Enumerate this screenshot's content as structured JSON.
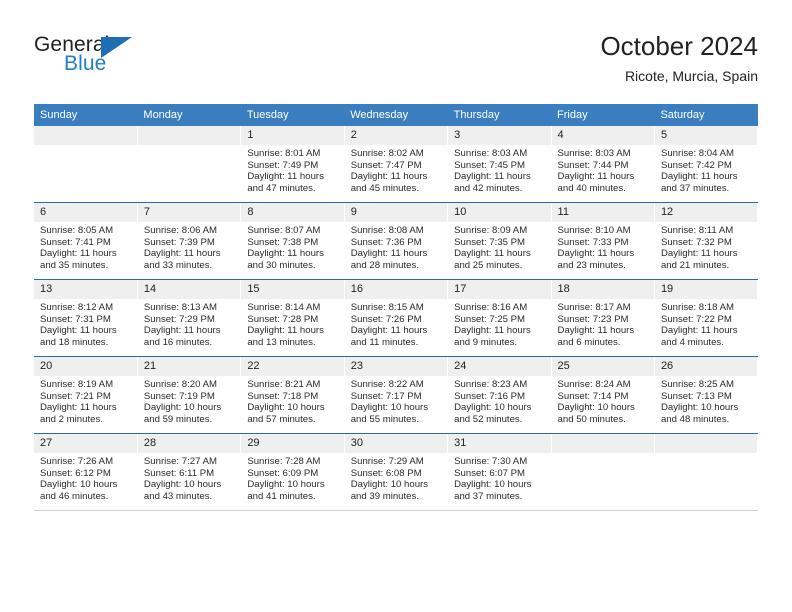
{
  "brand": {
    "name_top": "General",
    "name_bottom": "Blue",
    "accent_color": "#1f7ec4",
    "triangle_color": "#1f6db5"
  },
  "header": {
    "title": "October 2024",
    "location": "Ricote, Murcia, Spain"
  },
  "theme": {
    "header_blue": "#3b7ebf",
    "row_border_blue": "#2a6bab",
    "daynum_band": "#efefef",
    "text": "#222222"
  },
  "weekday_headers": [
    "Sunday",
    "Monday",
    "Tuesday",
    "Wednesday",
    "Thursday",
    "Friday",
    "Saturday"
  ],
  "weeks": [
    [
      {
        "day": "",
        "sunrise": "",
        "sunset": "",
        "daylight_line1": "",
        "daylight_line2": ""
      },
      {
        "day": "",
        "sunrise": "",
        "sunset": "",
        "daylight_line1": "",
        "daylight_line2": ""
      },
      {
        "day": "1",
        "sunrise": "Sunrise: 8:01 AM",
        "sunset": "Sunset: 7:49 PM",
        "daylight_line1": "Daylight: 11 hours",
        "daylight_line2": "and 47 minutes."
      },
      {
        "day": "2",
        "sunrise": "Sunrise: 8:02 AM",
        "sunset": "Sunset: 7:47 PM",
        "daylight_line1": "Daylight: 11 hours",
        "daylight_line2": "and 45 minutes."
      },
      {
        "day": "3",
        "sunrise": "Sunrise: 8:03 AM",
        "sunset": "Sunset: 7:45 PM",
        "daylight_line1": "Daylight: 11 hours",
        "daylight_line2": "and 42 minutes."
      },
      {
        "day": "4",
        "sunrise": "Sunrise: 8:03 AM",
        "sunset": "Sunset: 7:44 PM",
        "daylight_line1": "Daylight: 11 hours",
        "daylight_line2": "and 40 minutes."
      },
      {
        "day": "5",
        "sunrise": "Sunrise: 8:04 AM",
        "sunset": "Sunset: 7:42 PM",
        "daylight_line1": "Daylight: 11 hours",
        "daylight_line2": "and 37 minutes."
      }
    ],
    [
      {
        "day": "6",
        "sunrise": "Sunrise: 8:05 AM",
        "sunset": "Sunset: 7:41 PM",
        "daylight_line1": "Daylight: 11 hours",
        "daylight_line2": "and 35 minutes."
      },
      {
        "day": "7",
        "sunrise": "Sunrise: 8:06 AM",
        "sunset": "Sunset: 7:39 PM",
        "daylight_line1": "Daylight: 11 hours",
        "daylight_line2": "and 33 minutes."
      },
      {
        "day": "8",
        "sunrise": "Sunrise: 8:07 AM",
        "sunset": "Sunset: 7:38 PM",
        "daylight_line1": "Daylight: 11 hours",
        "daylight_line2": "and 30 minutes."
      },
      {
        "day": "9",
        "sunrise": "Sunrise: 8:08 AM",
        "sunset": "Sunset: 7:36 PM",
        "daylight_line1": "Daylight: 11 hours",
        "daylight_line2": "and 28 minutes."
      },
      {
        "day": "10",
        "sunrise": "Sunrise: 8:09 AM",
        "sunset": "Sunset: 7:35 PM",
        "daylight_line1": "Daylight: 11 hours",
        "daylight_line2": "and 25 minutes."
      },
      {
        "day": "11",
        "sunrise": "Sunrise: 8:10 AM",
        "sunset": "Sunset: 7:33 PM",
        "daylight_line1": "Daylight: 11 hours",
        "daylight_line2": "and 23 minutes."
      },
      {
        "day": "12",
        "sunrise": "Sunrise: 8:11 AM",
        "sunset": "Sunset: 7:32 PM",
        "daylight_line1": "Daylight: 11 hours",
        "daylight_line2": "and 21 minutes."
      }
    ],
    [
      {
        "day": "13",
        "sunrise": "Sunrise: 8:12 AM",
        "sunset": "Sunset: 7:31 PM",
        "daylight_line1": "Daylight: 11 hours",
        "daylight_line2": "and 18 minutes."
      },
      {
        "day": "14",
        "sunrise": "Sunrise: 8:13 AM",
        "sunset": "Sunset: 7:29 PM",
        "daylight_line1": "Daylight: 11 hours",
        "daylight_line2": "and 16 minutes."
      },
      {
        "day": "15",
        "sunrise": "Sunrise: 8:14 AM",
        "sunset": "Sunset: 7:28 PM",
        "daylight_line1": "Daylight: 11 hours",
        "daylight_line2": "and 13 minutes."
      },
      {
        "day": "16",
        "sunrise": "Sunrise: 8:15 AM",
        "sunset": "Sunset: 7:26 PM",
        "daylight_line1": "Daylight: 11 hours",
        "daylight_line2": "and 11 minutes."
      },
      {
        "day": "17",
        "sunrise": "Sunrise: 8:16 AM",
        "sunset": "Sunset: 7:25 PM",
        "daylight_line1": "Daylight: 11 hours",
        "daylight_line2": "and 9 minutes."
      },
      {
        "day": "18",
        "sunrise": "Sunrise: 8:17 AM",
        "sunset": "Sunset: 7:23 PM",
        "daylight_line1": "Daylight: 11 hours",
        "daylight_line2": "and 6 minutes."
      },
      {
        "day": "19",
        "sunrise": "Sunrise: 8:18 AM",
        "sunset": "Sunset: 7:22 PM",
        "daylight_line1": "Daylight: 11 hours",
        "daylight_line2": "and 4 minutes."
      }
    ],
    [
      {
        "day": "20",
        "sunrise": "Sunrise: 8:19 AM",
        "sunset": "Sunset: 7:21 PM",
        "daylight_line1": "Daylight: 11 hours",
        "daylight_line2": "and 2 minutes."
      },
      {
        "day": "21",
        "sunrise": "Sunrise: 8:20 AM",
        "sunset": "Sunset: 7:19 PM",
        "daylight_line1": "Daylight: 10 hours",
        "daylight_line2": "and 59 minutes."
      },
      {
        "day": "22",
        "sunrise": "Sunrise: 8:21 AM",
        "sunset": "Sunset: 7:18 PM",
        "daylight_line1": "Daylight: 10 hours",
        "daylight_line2": "and 57 minutes."
      },
      {
        "day": "23",
        "sunrise": "Sunrise: 8:22 AM",
        "sunset": "Sunset: 7:17 PM",
        "daylight_line1": "Daylight: 10 hours",
        "daylight_line2": "and 55 minutes."
      },
      {
        "day": "24",
        "sunrise": "Sunrise: 8:23 AM",
        "sunset": "Sunset: 7:16 PM",
        "daylight_line1": "Daylight: 10 hours",
        "daylight_line2": "and 52 minutes."
      },
      {
        "day": "25",
        "sunrise": "Sunrise: 8:24 AM",
        "sunset": "Sunset: 7:14 PM",
        "daylight_line1": "Daylight: 10 hours",
        "daylight_line2": "and 50 minutes."
      },
      {
        "day": "26",
        "sunrise": "Sunrise: 8:25 AM",
        "sunset": "Sunset: 7:13 PM",
        "daylight_line1": "Daylight: 10 hours",
        "daylight_line2": "and 48 minutes."
      }
    ],
    [
      {
        "day": "27",
        "sunrise": "Sunrise: 7:26 AM",
        "sunset": "Sunset: 6:12 PM",
        "daylight_line1": "Daylight: 10 hours",
        "daylight_line2": "and 46 minutes."
      },
      {
        "day": "28",
        "sunrise": "Sunrise: 7:27 AM",
        "sunset": "Sunset: 6:11 PM",
        "daylight_line1": "Daylight: 10 hours",
        "daylight_line2": "and 43 minutes."
      },
      {
        "day": "29",
        "sunrise": "Sunrise: 7:28 AM",
        "sunset": "Sunset: 6:09 PM",
        "daylight_line1": "Daylight: 10 hours",
        "daylight_line2": "and 41 minutes."
      },
      {
        "day": "30",
        "sunrise": "Sunrise: 7:29 AM",
        "sunset": "Sunset: 6:08 PM",
        "daylight_line1": "Daylight: 10 hours",
        "daylight_line2": "and 39 minutes."
      },
      {
        "day": "31",
        "sunrise": "Sunrise: 7:30 AM",
        "sunset": "Sunset: 6:07 PM",
        "daylight_line1": "Daylight: 10 hours",
        "daylight_line2": "and 37 minutes."
      },
      {
        "day": "",
        "sunrise": "",
        "sunset": "",
        "daylight_line1": "",
        "daylight_line2": ""
      },
      {
        "day": "",
        "sunrise": "",
        "sunset": "",
        "daylight_line1": "",
        "daylight_line2": ""
      }
    ]
  ]
}
